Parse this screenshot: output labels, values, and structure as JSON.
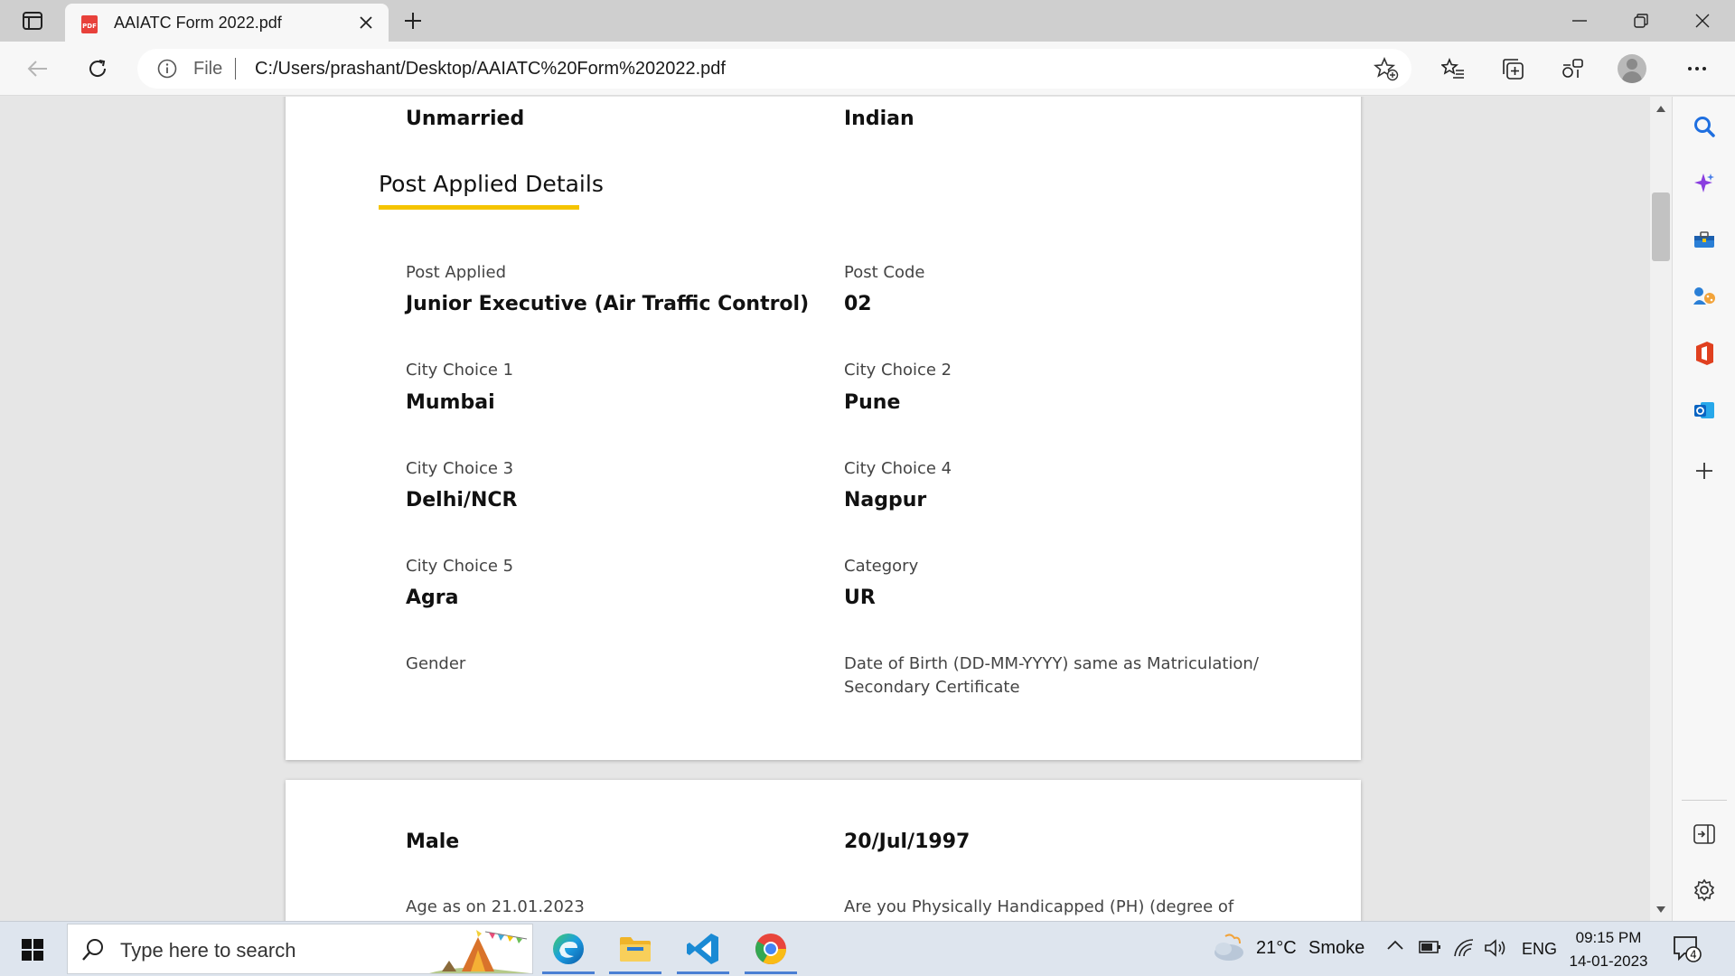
{
  "browser": {
    "tab": {
      "title": "AAIATC Form 2022.pdf",
      "icon": "pdf-icon"
    },
    "address": {
      "scheme_label": "File",
      "url": "C:/Users/prashant/Desktop/AAIATC%20Form%202022.pdf"
    }
  },
  "document": {
    "top_row": {
      "left_value": "Unmarried",
      "right_value": "Indian"
    },
    "section_title": "Post Applied Details",
    "accent_color": "#f5c400",
    "fields": [
      {
        "label": "Post Applied",
        "value": "Junior Executive (Air Traffic Control)"
      },
      {
        "label": "Post Code",
        "value": "02"
      },
      {
        "label": "City Choice 1",
        "value": "Mumbai"
      },
      {
        "label": "City Choice 2",
        "value": "Pune"
      },
      {
        "label": "City Choice 3",
        "value": "Delhi/NCR"
      },
      {
        "label": "City Choice 4",
        "value": "Nagpur"
      },
      {
        "label": "City Choice 5",
        "value": "Agra"
      },
      {
        "label": "Category",
        "value": "UR"
      }
    ],
    "gender_label": "Gender",
    "dob_label_line1": "Date of Birth (DD-MM-YYYY) same as Matriculation/",
    "dob_label_line2": "Secondary Certificate",
    "page2": {
      "gender_value": "Male",
      "dob_value": "20/Jul/1997",
      "age_label": "Age as on 21.01.2023",
      "ph_label": "Are you Physically Handicapped (PH) (degree of"
    }
  },
  "taskbar": {
    "search_placeholder": "Type here to search",
    "weather": {
      "temp": "21°C",
      "condition": "Smoke"
    },
    "language": "ENG",
    "time": "09:15 PM",
    "date": "14-01-2023",
    "notification_count": "4"
  }
}
